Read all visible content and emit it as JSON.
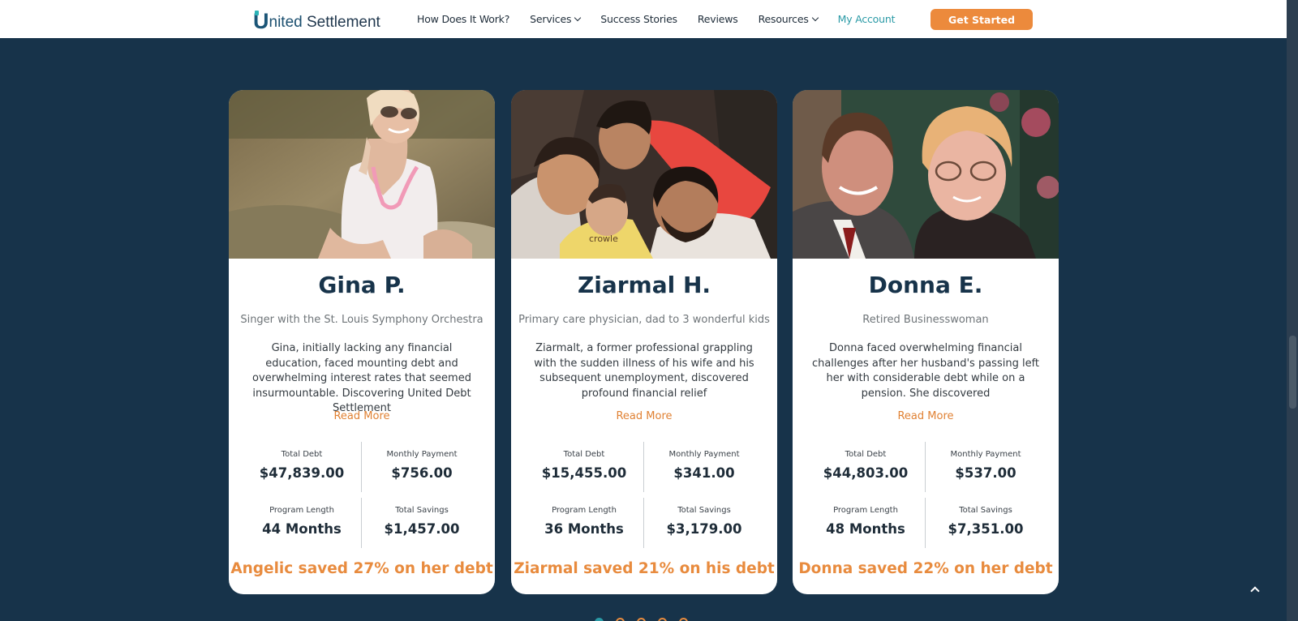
{
  "header": {
    "logo": {
      "initial": "U",
      "part1": "nited",
      "part2": "Settlement"
    },
    "nav": [
      {
        "label": "How Does It Work?",
        "dropdown": false
      },
      {
        "label": "Services",
        "dropdown": true
      },
      {
        "label": "Success Stories",
        "dropdown": false
      },
      {
        "label": "Reviews",
        "dropdown": false
      },
      {
        "label": "Resources",
        "dropdown": true
      },
      {
        "label": "My Account",
        "dropdown": false
      }
    ],
    "cta": "Get Started"
  },
  "cards": [
    {
      "photo": "woman-in-white-tank-top-sitting-on-grass",
      "name": "Gina P.",
      "role": "Singer with the St. Louis Symphony Orchestra",
      "text": "Gina, initially lacking any financial education, faced mounting debt and overwhelming interest rates that seemed insurmountable. Discovering United Debt Settlement",
      "read_more": "Read More",
      "stats": {
        "total_debt_label": "Total Debt",
        "total_debt": "$47,839.00",
        "monthly_payment_label": "Monthly Payment",
        "monthly_payment": "$756.00",
        "program_length_label": "Program Length",
        "program_length": "44 Months",
        "total_savings_label": "Total Savings",
        "total_savings": "$1,457.00"
      },
      "saved": "Angelic saved 27% on her debt"
    },
    {
      "photo": "family-selfie-with-three-children",
      "name": "Ziarmal H.",
      "role": "Primary care physician, dad to 3 wonderful kids",
      "text": "Ziarmalt, a former professional grappling with the sudden illness of his wife and his subsequent unemployment, discovered profound financial relief",
      "read_more": "Read More",
      "stats": {
        "total_debt_label": "Total Debt",
        "total_debt": "$15,455.00",
        "monthly_payment_label": "Monthly Payment",
        "monthly_payment": "$341.00",
        "program_length_label": "Program Length",
        "program_length": "36 Months",
        "total_savings_label": "Total Savings",
        "total_savings": "$3,179.00"
      },
      "saved": "Ziarmal saved 21% on his debt"
    },
    {
      "photo": "older-couple-portrait",
      "name": "Donna E.",
      "role": "Retired Businesswoman",
      "text": "Donna faced overwhelming financial challenges after her husband's passing left her with considerable debt while on a pension. She discovered",
      "read_more": "Read More",
      "stats": {
        "total_debt_label": "Total Debt",
        "total_debt": "$44,803.00",
        "monthly_payment_label": "Monthly Payment",
        "monthly_payment": "$537.00",
        "program_length_label": "Program Length",
        "program_length": "48 Months",
        "total_savings_label": "Total Savings",
        "total_savings": "$7,351.00"
      },
      "saved": "Donna saved 22% on her debt"
    }
  ],
  "carousel": {
    "dots": 5,
    "active_index": 0
  },
  "icons": {
    "back_to_top": "chevron-up-icon"
  },
  "colors": {
    "background": "#17334a",
    "accent": "#ec8a3c",
    "teal": "#2a9aa6",
    "heading": "#17334a"
  }
}
